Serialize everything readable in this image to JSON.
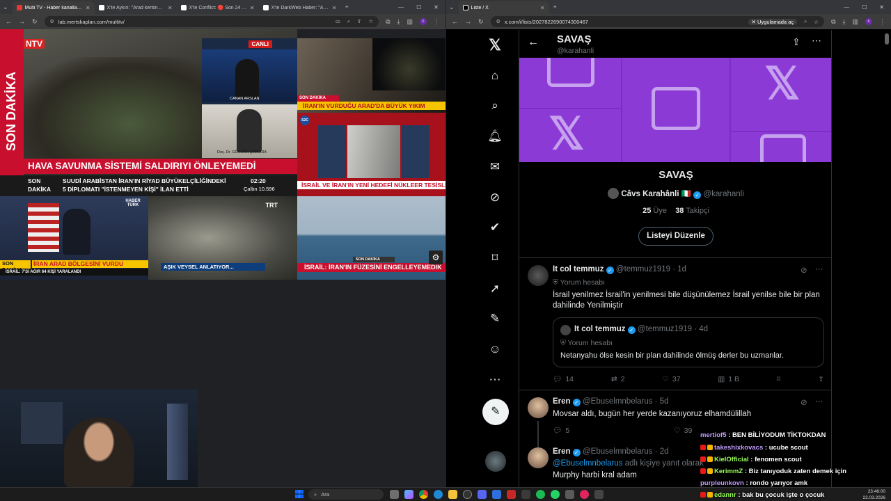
{
  "left_browser": {
    "tabs": [
      {
        "label": "Multi TV - Haber kanallarını ay",
        "active": true,
        "fav_color": "#e53935"
      },
      {
        "label": "X'te Aykırı: \"Arad kentine onlar",
        "active": false,
        "fav_color": "#ffffff"
      },
      {
        "label": "X'te Conflict: 🔴 Son 24 saatt",
        "active": false,
        "fav_color": "#ffffff"
      },
      {
        "label": "X'te DarkWeb Haber: \"AK Parti",
        "active": false,
        "fav_color": "#ffffff"
      }
    ],
    "url": "lab.mertskaplan.com/multitv/",
    "profile_letter": "c",
    "channels": {
      "ntv": {
        "logo": "NTV",
        "side_label": "SON DAKİKA",
        "headline": "HAVA SAVUNMA SİSTEMİ SALDIRIYI ÖNLEYEMEDİ",
        "ticker_label_1": "SON",
        "ticker_label_2": "DAKİKA",
        "ticker_1": "SUUDİ ARABİSTAN İRAN'IN RİYAD BÜYÜKELÇİLİĞİNDEKİ",
        "ticker_2": "5 DİPLOMATI \"İSTENMEYEN KİŞİ\" İLAN ETTİ",
        "time": "02:20",
        "market": "Çalbn 10.596"
      },
      "news2": {
        "live": "CANLI",
        "anchor": "CANAN ARSLAN",
        "guest": "Doç. Dr. GÖKHAN ÇINKARA"
      },
      "news3": {
        "label": "SON DAKİKA",
        "headline": "İRAN'IN VURDUĞU ARAD'DA BÜYÜK YIKIM"
      },
      "news4": {
        "logo": "S2C",
        "headline": "İSRAİL VE İRAN'IN YENİ HEDEFİ NÜKLEER TESİSLER"
      },
      "haberturk": {
        "logo": "HABER TÜRK",
        "label": "SON DAKİKA",
        "headline": "İRAN ARAD BÖLGESİNİ VURDU",
        "ticker": "İSRAİL: 7'Sİ AĞIR 64 KİŞİ YARALANDI"
      },
      "trt": {
        "logo": "TRT",
        "headline": "AŞIK VEYSEL ANLATIYOR..."
      },
      "sea": {
        "label": "SON DAKİKA",
        "headline": "İSRAİL: İRAN'IN FÜZESİNİ ENGELLEYEMEDİK"
      }
    }
  },
  "right_browser": {
    "tab_label": "Liste / X",
    "url": "x.com/i/lists/2027822690074300467",
    "app_button": "Uygulamada aç",
    "profile_letter": "c",
    "header": {
      "title": "SAVAŞ",
      "handle": "@karahanli"
    },
    "list": {
      "name": "SAVAŞ",
      "owner_name": "Câvs Karahânli 🇮🇹",
      "owner_handle": "@karahanli",
      "members_count": "25",
      "members_label": "Üye",
      "followers_count": "38",
      "followers_label": "Takipçi",
      "edit_button": "Listeyi Düzenle"
    },
    "tweets": [
      {
        "name": "It col temmuz",
        "handle": "@temmuz1919",
        "age": "· 1d",
        "label": "Yorum hesabı",
        "text": "İsrail yenilmez İsrail'in yenilmesi bile düşünülemez İsrail yenilse bile bir plan dahilinde Yenilmiştir",
        "quote": {
          "name": "It col temmuz",
          "handle": "@temmuz1919",
          "age": "· 4d",
          "label": "Yorum hesabı",
          "text": "Netanyahu ölse kesin bir plan dahilinde ölmüş derler bu uzmanlar."
        },
        "replies": "14",
        "retweets": "2",
        "likes": "37",
        "views": "1 B"
      },
      {
        "name": "Eren",
        "handle": "@Ebuselmnbelarus",
        "age": "· 5d",
        "text": "Movsar aldı, bugün her yerde kazanıyoruz elhamdülillah",
        "replies": "5",
        "likes": "39"
      },
      {
        "name": "Eren",
        "handle": "@Ebuselmnbelarus",
        "age": "· 2d",
        "reply_to": "@Ebuselmnbelarus",
        "reply_suffix": "adlı kişiye yanıt olarak",
        "text": "Murphy harbi kral adam"
      }
    ]
  },
  "chat": [
    {
      "user": "mertiof5",
      "msg": "BEN BİLİYODUM TİKTOKDAN",
      "color": "#c39bff"
    },
    {
      "user": "takeshixkovacs",
      "msg": "ucube scout",
      "color": "#c39bff"
    },
    {
      "user": "KielOfficial",
      "msg": "fenomen scout",
      "color": "#9cff5a"
    },
    {
      "user": "KerimmZ",
      "msg": "Biz tanıyoduk zaten demek için",
      "color": "#9cff5a"
    },
    {
      "user": "purpleunkovn",
      "msg": "rondo yarıyor amk",
      "color": "#c39bff"
    },
    {
      "user": "edannr",
      "msg": "bak bu çocuk işte o çocuk",
      "color": "#9cff5a"
    }
  ],
  "taskbar": {
    "search_placeholder": "Ara",
    "time": "23:46:00",
    "date": "22.03.2026"
  },
  "colors": {
    "list_banner": "#8c3ad6",
    "x_blue": "#1d9bf0",
    "news_red": "#d81e1e"
  }
}
